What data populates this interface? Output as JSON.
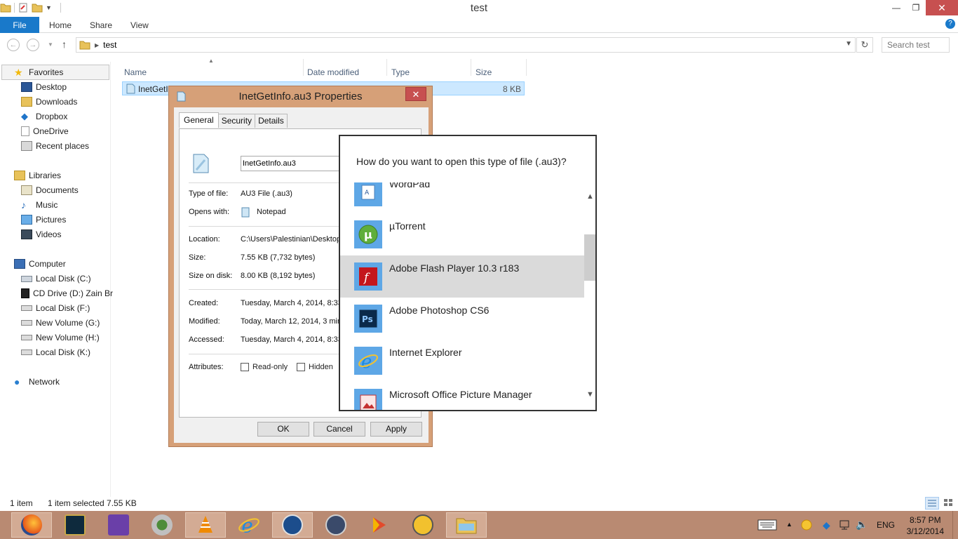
{
  "window": {
    "title": "test",
    "min_glyph": "—",
    "max_glyph": "❐",
    "close_glyph": "✕"
  },
  "ribbon": {
    "file": "File",
    "tabs": [
      "Home",
      "Share",
      "View"
    ],
    "help": "?"
  },
  "address": {
    "crumb": "test",
    "search_placeholder": "Search test"
  },
  "nav": {
    "favorites_header": "Favorites",
    "favorites": [
      "Desktop",
      "Downloads",
      "Dropbox",
      "OneDrive",
      "Recent places"
    ],
    "libraries_header": "Libraries",
    "libraries": [
      "Documents",
      "Music",
      "Pictures",
      "Videos"
    ],
    "computer_header": "Computer",
    "drives": [
      "Local Disk (C:)",
      "CD Drive (D:) Zain Br",
      "Local Disk (F:)",
      "New Volume (G:)",
      "New Volume (H:)",
      "Local Disk (K:)"
    ],
    "network": "Network"
  },
  "filelist": {
    "columns": [
      "Name",
      "Date modified",
      "Type",
      "Size"
    ],
    "rows": [
      {
        "name": "InetGetInfo.au3",
        "size": "8 KB"
      }
    ]
  },
  "status": {
    "count": "1 item",
    "selection": "1 item selected  7.55 KB"
  },
  "properties": {
    "title": "InetGetInfo.au3 Properties",
    "tabs": [
      "General",
      "Security",
      "Details"
    ],
    "filename": "InetGetInfo.au3",
    "type_label": "Type of file:",
    "type_value": "AU3 File (.au3)",
    "opens_label": "Opens with:",
    "opens_value": "Notepad",
    "location_label": "Location:",
    "location_value": "C:\\Users\\Palestinian\\Desktop",
    "size_label": "Size:",
    "size_value": "7.55 KB (7,732 bytes)",
    "sizeondisk_label": "Size on disk:",
    "sizeondisk_value": "8.00 KB (8,192 bytes)",
    "created_label": "Created:",
    "created_value": "Tuesday, March 4, 2014, 8:33",
    "modified_label": "Modified:",
    "modified_value": "Today, March 12, 2014, 3 min",
    "accessed_label": "Accessed:",
    "accessed_value": "Tuesday, March 4, 2014, 8:33",
    "attributes_label": "Attributes:",
    "readonly": "Read-only",
    "hidden": "Hidden",
    "ok": "OK",
    "cancel": "Cancel",
    "apply": "Apply"
  },
  "openwith": {
    "question": "How do you want to open this type of file (.au3)?",
    "apps": [
      {
        "name": "WordPad",
        "icon": "wordpad-icon"
      },
      {
        "name": "µTorrent",
        "icon": "utorrent-icon"
      },
      {
        "name": "Adobe Flash Player 10.3 r183",
        "icon": "flash-player-icon",
        "selected": true
      },
      {
        "name": "Adobe Photoshop CS6",
        "icon": "photoshop-icon"
      },
      {
        "name": "Internet Explorer",
        "icon": "internet-explorer-icon"
      },
      {
        "name": "Microsoft Office Picture Manager",
        "icon": "picture-manager-icon"
      }
    ]
  },
  "taskbar": {
    "apps": [
      "firefox-icon",
      "league-of-legends-icon",
      "visual-studio-icon",
      "webcam-icon",
      "vlc-icon",
      "internet-explorer-icon",
      "autoit-icon",
      "autoit-v3-icon",
      "plex-icon",
      "editor-icon",
      "file-explorer-icon"
    ],
    "lang": "ENG",
    "time": "8:57 PM",
    "date": "3/12/2014"
  },
  "colors": {
    "accent": "#1979ca",
    "selection": "#cce8ff",
    "taskbar": "#b98a72",
    "dialog_frame": "#d6a078",
    "close_red": "#c75050"
  }
}
